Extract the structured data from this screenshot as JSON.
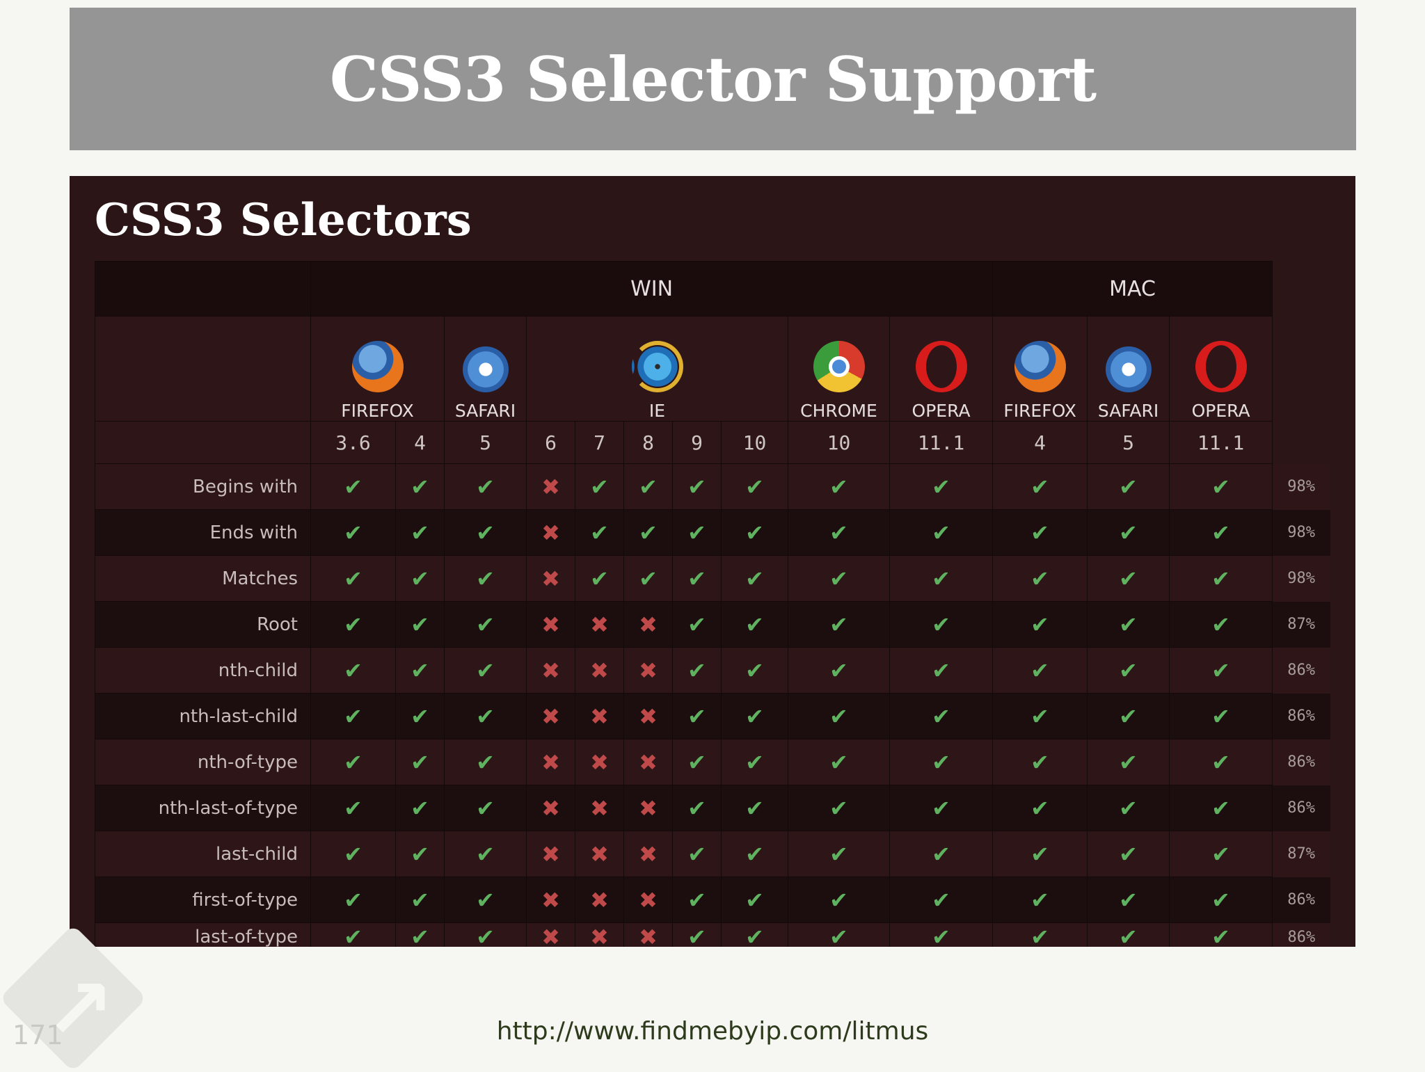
{
  "slide": {
    "title": "CSS3 Selector Support",
    "url": "http://www.findmebyip.com/litmus",
    "page_number": "171"
  },
  "screenshot": {
    "title": "CSS3 Selectors",
    "groups": {
      "win": "WIN",
      "mac": "MAC"
    },
    "browsers": [
      {
        "name": "FIREFOX",
        "icon": "firefox-icon"
      },
      {
        "name": "SAFARI",
        "icon": "safari-icon"
      },
      {
        "name": "IE",
        "icon": "ie-icon"
      },
      {
        "name": "CHROME",
        "icon": "chrome-icon"
      },
      {
        "name": "OPERA",
        "icon": "opera-icon"
      },
      {
        "name": "FIREFOX",
        "icon": "firefox-icon"
      },
      {
        "name": "SAFARI",
        "icon": "safari-icon"
      },
      {
        "name": "OPERA",
        "icon": "opera-icon"
      }
    ],
    "versions": [
      "3.6",
      "4",
      "5",
      "6",
      "7",
      "8",
      "9",
      "10",
      "10",
      "11.1",
      "4",
      "5",
      "11.1"
    ],
    "symbols": {
      "yes": "✔",
      "no": "✖"
    },
    "rows": [
      {
        "label": "Begins with",
        "support": [
          1,
          1,
          1,
          0,
          1,
          1,
          1,
          1,
          1,
          1,
          1,
          1,
          1
        ],
        "percent": "98%"
      },
      {
        "label": "Ends with",
        "support": [
          1,
          1,
          1,
          0,
          1,
          1,
          1,
          1,
          1,
          1,
          1,
          1,
          1
        ],
        "percent": "98%"
      },
      {
        "label": "Matches",
        "support": [
          1,
          1,
          1,
          0,
          1,
          1,
          1,
          1,
          1,
          1,
          1,
          1,
          1
        ],
        "percent": "98%"
      },
      {
        "label": "Root",
        "support": [
          1,
          1,
          1,
          0,
          0,
          0,
          1,
          1,
          1,
          1,
          1,
          1,
          1
        ],
        "percent": "87%"
      },
      {
        "label": "nth-child",
        "support": [
          1,
          1,
          1,
          0,
          0,
          0,
          1,
          1,
          1,
          1,
          1,
          1,
          1
        ],
        "percent": "86%"
      },
      {
        "label": "nth-last-child",
        "support": [
          1,
          1,
          1,
          0,
          0,
          0,
          1,
          1,
          1,
          1,
          1,
          1,
          1
        ],
        "percent": "86%"
      },
      {
        "label": "nth-of-type",
        "support": [
          1,
          1,
          1,
          0,
          0,
          0,
          1,
          1,
          1,
          1,
          1,
          1,
          1
        ],
        "percent": "86%"
      },
      {
        "label": "nth-last-of-type",
        "support": [
          1,
          1,
          1,
          0,
          0,
          0,
          1,
          1,
          1,
          1,
          1,
          1,
          1
        ],
        "percent": "86%"
      },
      {
        "label": "last-child",
        "support": [
          1,
          1,
          1,
          0,
          0,
          0,
          1,
          1,
          1,
          1,
          1,
          1,
          1
        ],
        "percent": "87%"
      },
      {
        "label": "first-of-type",
        "support": [
          1,
          1,
          1,
          0,
          0,
          0,
          1,
          1,
          1,
          1,
          1,
          1,
          1
        ],
        "percent": "86%"
      },
      {
        "label": "last-of-type",
        "support": [
          1,
          1,
          1,
          0,
          0,
          0,
          1,
          1,
          1,
          1,
          1,
          1,
          1
        ],
        "percent": "86%"
      }
    ]
  },
  "colors": {
    "title_bar": "#959595",
    "panel": "#2c1517",
    "yes": "#5fb25f",
    "no": "#c04a4a"
  }
}
